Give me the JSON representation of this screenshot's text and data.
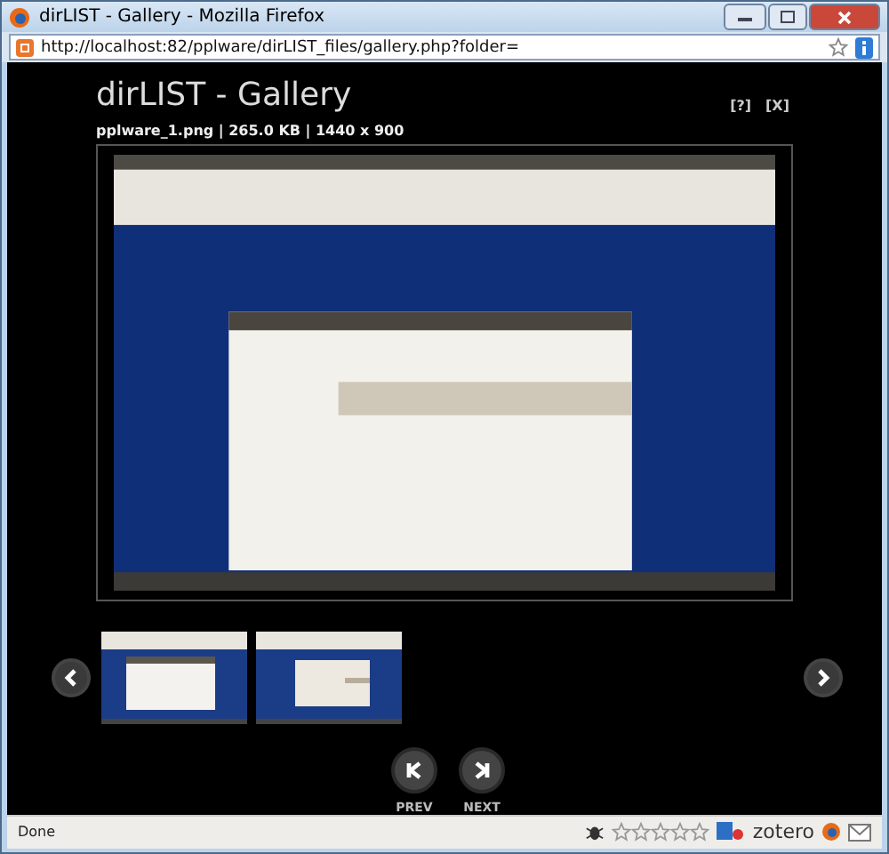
{
  "window": {
    "title": "dirLIST - Gallery - Mozilla Firefox"
  },
  "address_bar": {
    "url": "http://localhost:82/pplware/dirLIST_files/gallery.php?folder="
  },
  "gallery": {
    "title": "dirLIST - Gallery",
    "links": [
      "[?]",
      "[X]"
    ],
    "file_info": "pplware_1.png | 265.0 KB | 1440 x 900"
  },
  "thumbnails": [
    {
      "kind": "browser"
    },
    {
      "kind": "dialog"
    }
  ],
  "pager": [
    {
      "kind": "prev",
      "label": "PREV"
    },
    {
      "kind": "next",
      "label": "NEXT"
    }
  ],
  "status_bar": {
    "text": "Done",
    "rating": {
      "stars": 0
    },
    "zotero": "zotero"
  }
}
